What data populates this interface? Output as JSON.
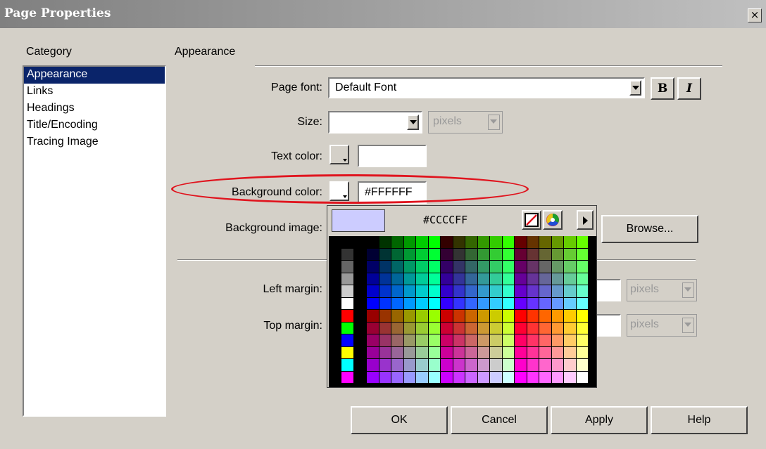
{
  "window": {
    "title": "Page Properties",
    "close_symbol": "×"
  },
  "category": {
    "label": "Category",
    "items": [
      "Appearance",
      "Links",
      "Headings",
      "Title/Encoding",
      "Tracing Image"
    ],
    "selected": "Appearance"
  },
  "section": {
    "title": "Appearance"
  },
  "page_font": {
    "label": "Page font:",
    "value": "Default Font",
    "bold_label": "B",
    "italic_label": "I"
  },
  "size": {
    "label": "Size:",
    "value": "",
    "unit": "pixels"
  },
  "text_color": {
    "label": "Text color:",
    "value": ""
  },
  "background_color": {
    "label": "Background color:",
    "value": "#FFFFFF"
  },
  "background_image": {
    "label": "Background image:",
    "value": "",
    "browse_label": "Browse..."
  },
  "left_margin": {
    "label": "Left margin:",
    "value": "",
    "unit": "pixels"
  },
  "top_margin": {
    "label": "Top margin:",
    "value": "",
    "unit": "pixels"
  },
  "color_picker": {
    "hex": "#CCCCFF",
    "preview_color": "#ccccff"
  },
  "buttons": {
    "ok": "OK",
    "cancel": "Cancel",
    "apply": "Apply",
    "help": "Help"
  },
  "colors": {
    "highlight": "#0a246a",
    "annotation": "#e0141e"
  }
}
